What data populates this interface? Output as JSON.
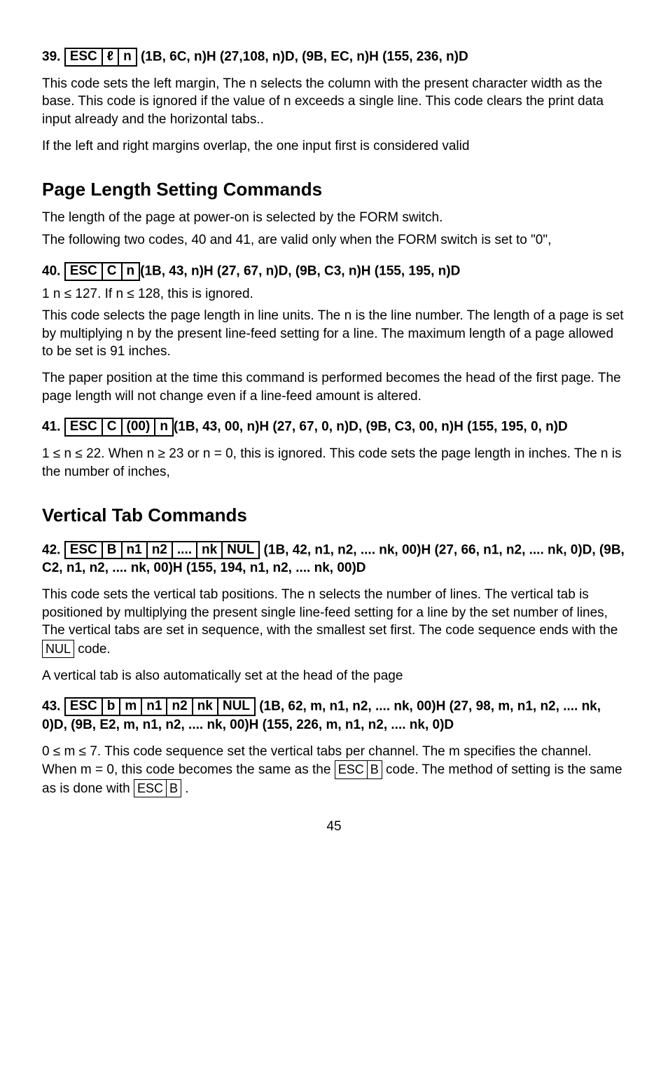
{
  "item39": {
    "num": "39.",
    "box": [
      "ESC",
      "ℓ",
      "n"
    ],
    "tail": " (1B, 6C, n)H (27,108, n)D, (9B, EC, n)H (155, 236, n)D",
    "p1": "This code sets the left margin, The n selects the column with the present character width as the base. This code is ignored if the value of n exceeds a single line. This code clears the print data input already and the horizontal tabs..",
    "p2": "If the left and right margins overlap, the one input first is considered valid"
  },
  "section_page_length": {
    "title": "Page Length Setting Commands",
    "intro1": "The length of the page at power-on is selected by the FORM switch.",
    "intro2": "The following two codes, 40 and 41, are valid only when the FORM switch is set to \"0\","
  },
  "item40": {
    "num": "40.",
    "box": [
      "ESC",
      "C",
      "n"
    ],
    "tail": "(1B, 43, n)H (27, 67, n)D, (9B, C3, n)H (155, 195, n)D",
    "p0": "1 n ≤ 127. If n  ≤ 128, this is ignored.",
    "p1": "This code selects the page length in line units. The n is the line number. The length of a page is set by multiplying n by the present line-feed setting for a line. The maximum length of a page allowed to be set is 91 inches.",
    "p2": "The paper position at the time this command is performed becomes the head of the first page. The page length will not change even if a line-feed amount is altered."
  },
  "item41": {
    "num": "41.",
    "box": [
      "ESC",
      "C",
      "(00)",
      "n"
    ],
    "tail": "(1B, 43, 00, n)H (27, 67, 0, n)D, (9B, C3, 00, n)H (155, 195, 0, n)D",
    "p1a": "1  ≤ n ≤ 22. When n ≥ 23 or n = 0, this is ignored. This code sets the page length in inches. The n is the number of inches,"
  },
  "section_vtab": {
    "title": "Vertical Tab Commands"
  },
  "item42": {
    "num": "42.",
    "box": [
      "ESC",
      "B",
      "n1",
      "n2",
      "....",
      "nk",
      "NUL"
    ],
    "tail": "    (1B, 42, n1, n2, .... nk, 00)H (27, 66, n1, n2, .... nk, 0)D, (9B, C2, n1, n2, .... nk, 00)H (155, 194, n1, n2, .... nk, 00)D",
    "p1a": "This code sets the vertical tab positions. The n selects the number of lines. The vertical tab is positioned by multiplying the present single line-feed setting for a line by the set number of lines, The vertical tabs are set in sequence, with the smallest set first. The code sequence ends with the",
    "p1box": "NUL",
    "p1b": " code.",
    "p2": "A vertical tab is also automatically set at the head of the page"
  },
  "item43": {
    "num": "43.",
    "box": [
      "ESC",
      "b",
      "m",
      "n1",
      "n2",
      "nk",
      "NUL"
    ],
    "tail": "      (1B, 62, m, n1, n2, .... nk, 00)H (27, 98, m, n1, n2, .... nk, 0)D, (9B, E2, m, n1, n2, .... nk, 00)H (155, 226, m, n1, n2, .... nk, 0)D",
    "p1a": "0 ≤ m ≤ 7. This code sequence set the vertical tabs per channel. The m specifies the channel. When m = 0, this code becomes the same as the   ",
    "p1box1": [
      "ESC",
      "B"
    ],
    "p1b": " code.  The method of setting is the same as is done with ",
    "p1box2": [
      "ESC",
      "B"
    ],
    "p1c": " ."
  },
  "pagenum": "45"
}
